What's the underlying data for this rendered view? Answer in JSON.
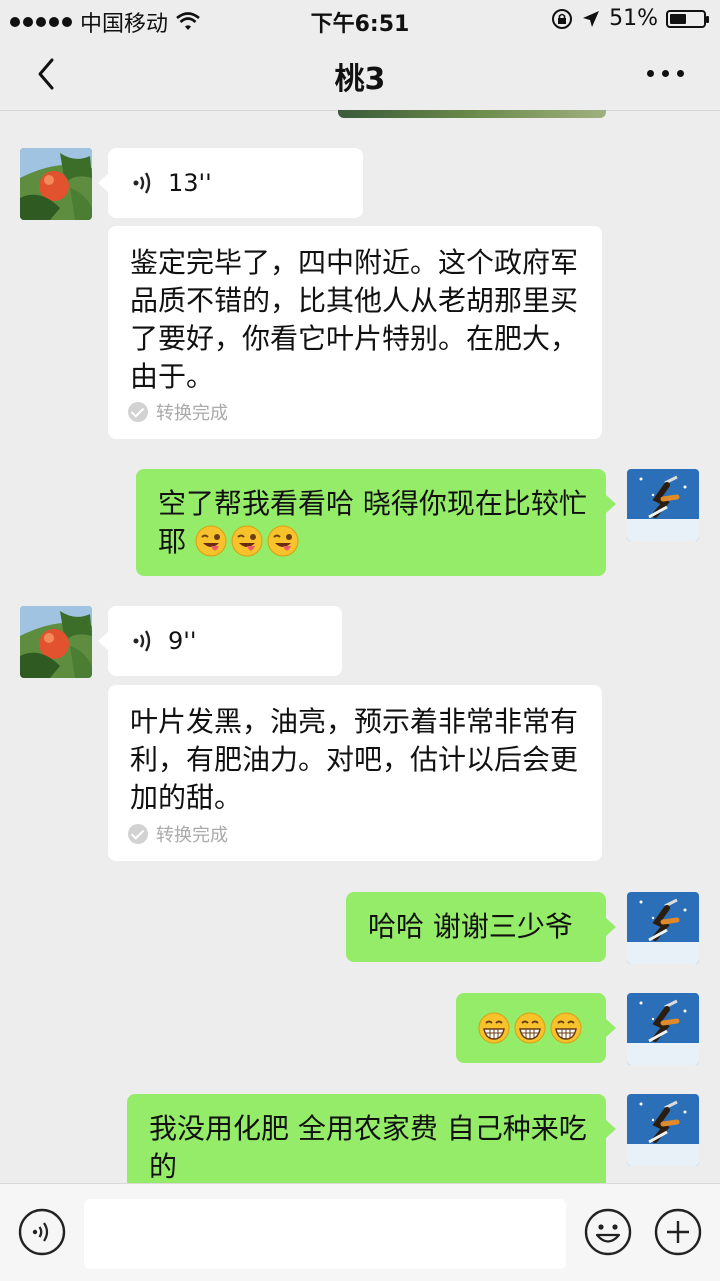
{
  "status_bar": {
    "carrier": "中国移动",
    "time": "下午6:51",
    "battery": "51%",
    "battery_level": 0.51
  },
  "nav": {
    "title": "桃3",
    "back_icon": "chevron-left-icon",
    "more_icon": "more-dots-icon"
  },
  "messages": [
    {
      "side": "in",
      "type": "voice",
      "duration": "13''"
    },
    {
      "side": "in",
      "type": "text",
      "text": "鉴定完毕了，四中附近。这个政府军品质不错的，比其他人从老胡那里买了要好，你看它叶片特别。在肥大，由于。",
      "status": "转换完成"
    },
    {
      "side": "out",
      "type": "text",
      "text": "空了帮我看看哈 晓得你现在比较忙耶",
      "emoji": "winking-tongue-face x3"
    },
    {
      "side": "in",
      "type": "voice",
      "duration": "9''"
    },
    {
      "side": "in",
      "type": "text",
      "text": "叶片发黑，油亮，预示着非常非常有利，有肥油力。对吧，估计以后会更加的甜。",
      "status": "转换完成"
    },
    {
      "side": "out",
      "type": "text",
      "text": "哈哈 谢谢三少爷"
    },
    {
      "side": "out",
      "type": "emoji",
      "emoji": "grinning-face x3"
    },
    {
      "side": "out",
      "type": "text",
      "text": "我没用化肥 全用农家费 自己种来吃的"
    }
  ],
  "input_bar": {
    "voice_icon": "voice-mode-icon",
    "emoji_icon": "smiley-icon",
    "plus_icon": "plus-icon"
  },
  "colors": {
    "background": "#ededed",
    "out_bubble": "#95ec69",
    "in_bubble": "#ffffff"
  }
}
